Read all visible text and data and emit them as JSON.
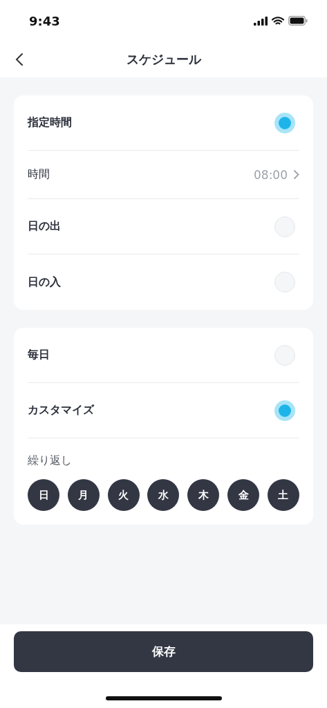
{
  "status_bar": {
    "time": "9:43"
  },
  "nav": {
    "title": "スケジュール"
  },
  "trigger_card": {
    "rows": [
      {
        "kind": "radio",
        "label": "指定時間",
        "selected": true
      },
      {
        "kind": "value",
        "label": "時間",
        "value": "08:00"
      },
      {
        "kind": "radio",
        "label": "日の出",
        "selected": false
      },
      {
        "kind": "radio",
        "label": "日の入",
        "selected": false
      }
    ]
  },
  "repeat_card": {
    "rows": [
      {
        "kind": "radio",
        "label": "毎日",
        "selected": false
      },
      {
        "kind": "radio",
        "label": "カスタマイズ",
        "selected": true
      }
    ],
    "repeat_label": "繰り返し",
    "days": [
      {
        "label": "日",
        "selected": true
      },
      {
        "label": "月",
        "selected": true
      },
      {
        "label": "火",
        "selected": true
      },
      {
        "label": "水",
        "selected": true
      },
      {
        "label": "木",
        "selected": true
      },
      {
        "label": "金",
        "selected": true
      },
      {
        "label": "土",
        "selected": true
      }
    ]
  },
  "save_button": "保存"
}
